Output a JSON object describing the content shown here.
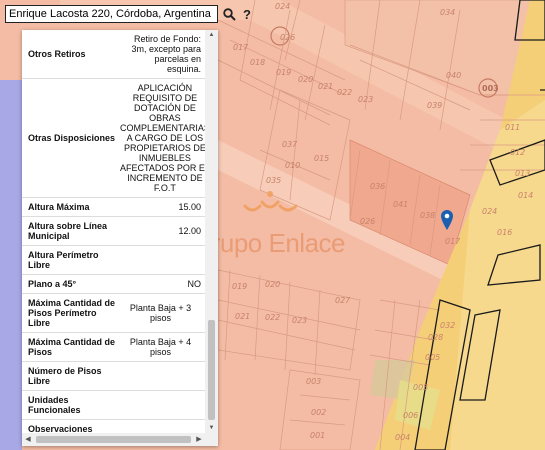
{
  "search": {
    "value": "Enrique Lacosta 220, Córdoba, Argentina",
    "search_icon": "search-icon",
    "help_label": "?"
  },
  "map": {
    "parcel_labels": [
      "024",
      "034",
      "026",
      "017",
      "018",
      "019",
      "020",
      "021",
      "022",
      "023",
      "040",
      "003",
      "039",
      "037",
      "011",
      "012",
      "013",
      "014",
      "015",
      "010",
      "035",
      "036",
      "041",
      "038",
      "026",
      "024",
      "016",
      "017",
      "019",
      "020",
      "021",
      "022",
      "023",
      "027",
      "028",
      "005",
      "005",
      "006",
      "004",
      "003",
      "002",
      "001",
      "032",
      "033",
      "020",
      "007",
      "008",
      "009",
      "010",
      "030",
      "031",
      "006",
      "005"
    ],
    "zone_colors": {
      "residential": "#f4c0a8",
      "commercial": "#f5cc74",
      "light": "#f8d6c4",
      "block": "#fbe0cf"
    }
  },
  "watermark": {
    "text": "Grupo Enlace"
  },
  "panel": {
    "rows": [
      {
        "label": "Otros Retiros",
        "value": [
          "Retiro de Fondo:",
          "3m, excepto para",
          "parcelas en esquina."
        ]
      },
      {
        "label": "Otras Disposiciones",
        "value": [
          "APLICACIÓN",
          "REQUISITO DE",
          "DOTACIÓN DE",
          "OBRAS",
          "COMPLEMENTARIAS",
          "A CARGO DE LOS",
          "PROPIETARIOS DE",
          "INMUEBLES",
          "AFECTADOS POR EL",
          "INCREMENTO DE",
          "F.O.T"
        ]
      },
      {
        "label": "Altura Máxima",
        "value": [
          "15.00"
        ]
      },
      {
        "label": "Altura sobre Línea Municipal",
        "value": [
          "12.00"
        ]
      },
      {
        "label": "Altura Perímetro Libre",
        "value": [
          ""
        ]
      },
      {
        "label": "Plano a 45°",
        "value": [
          "NO"
        ]
      },
      {
        "label": "Máxima Cantidad de Pisos Perímetro Libre",
        "value": [
          "Planta Baja + 3",
          "pisos"
        ]
      },
      {
        "label": "Máxima Cantidad de Pisos",
        "value": [
          "Planta Baja + 4",
          "pisos"
        ]
      },
      {
        "label": "Número de Pisos Libre",
        "value": [
          ""
        ]
      },
      {
        "label": "Unidades Funcionales",
        "value": [
          ""
        ]
      },
      {
        "label": "Observaciones",
        "value": [
          ""
        ]
      }
    ]
  }
}
